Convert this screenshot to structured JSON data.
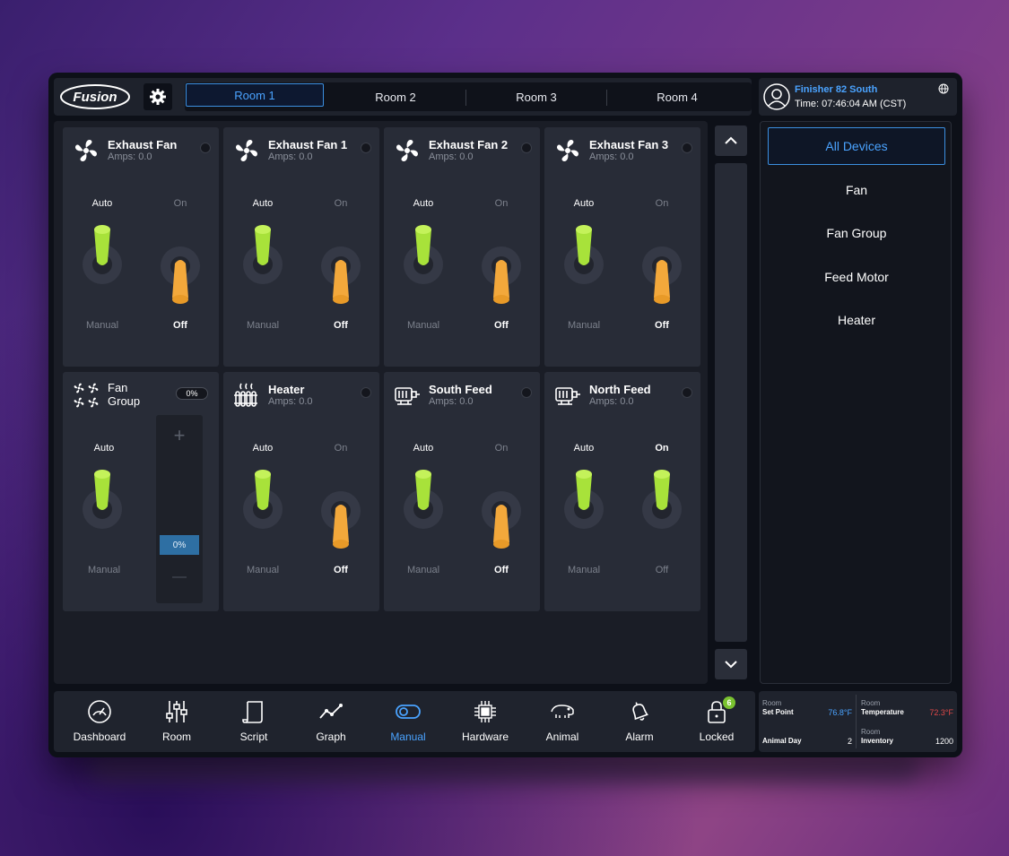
{
  "header": {
    "logo": "Fusion",
    "tabs": [
      {
        "label": "Room 1",
        "active": true
      },
      {
        "label": "Room 2",
        "active": false
      },
      {
        "label": "Room 3",
        "active": false
      },
      {
        "label": "Room 4",
        "active": false
      }
    ],
    "user": {
      "name": "Finisher 82 South",
      "time": "Time: 07:46:04 AM (CST)"
    }
  },
  "cards": [
    {
      "title": "Exhaust Fan",
      "sub": "Amps: 0.0",
      "icon": "fan-icon",
      "left": "Auto",
      "left_bottom": "Manual",
      "right": "On",
      "right_bottom": "Off",
      "left_state": "auto",
      "right_state": "off"
    },
    {
      "title": "Exhaust Fan 1",
      "sub": "Amps: 0.0",
      "icon": "fan-icon",
      "left": "Auto",
      "left_bottom": "Manual",
      "right": "On",
      "right_bottom": "Off",
      "left_state": "auto",
      "right_state": "off"
    },
    {
      "title": "Exhaust Fan 2",
      "sub": "Amps: 0.0",
      "icon": "fan-icon",
      "left": "Auto",
      "left_bottom": "Manual",
      "right": "On",
      "right_bottom": "Off",
      "left_state": "auto",
      "right_state": "off"
    },
    {
      "title": "Exhaust Fan 3",
      "sub": "Amps: 0.0",
      "icon": "fan-icon",
      "left": "Auto",
      "left_bottom": "Manual",
      "right": "On",
      "right_bottom": "Off",
      "left_state": "auto",
      "right_state": "off"
    },
    {
      "title_line1": "Fan",
      "title_line2": "Group",
      "icon": "fan-group-icon",
      "percent": "0%",
      "slider_value": "0%",
      "left": "Auto",
      "left_bottom": "Manual",
      "left_state": "auto",
      "slider_plus": "+",
      "slider_minus": "—"
    },
    {
      "title": "Heater",
      "sub": "Amps: 0.0",
      "icon": "heater-icon",
      "left": "Auto",
      "left_bottom": "Manual",
      "right": "On",
      "right_bottom": "Off",
      "left_state": "auto",
      "right_state": "off"
    },
    {
      "title": "South Feed",
      "sub": "Amps: 0.0",
      "icon": "feed-motor-icon",
      "left": "Auto",
      "left_bottom": "Manual",
      "right": "On",
      "right_bottom": "Off",
      "left_state": "auto",
      "right_state": "off"
    },
    {
      "title": "North Feed",
      "sub": "Amps: 0.0",
      "icon": "feed-motor-icon",
      "left": "Auto",
      "left_bottom": "Manual",
      "right": "On",
      "right_bottom": "Off",
      "left_state": "auto",
      "right_state": "on"
    }
  ],
  "filters": [
    {
      "label": "All Devices",
      "active": true
    },
    {
      "label": "Fan",
      "active": false
    },
    {
      "label": "Fan Group",
      "active": false
    },
    {
      "label": "Feed Motor",
      "active": false
    },
    {
      "label": "Heater",
      "active": false
    }
  ],
  "nav": [
    {
      "label": "Dashboard",
      "icon": "gauge-icon",
      "active": false
    },
    {
      "label": "Room",
      "icon": "sliders-icon",
      "active": false
    },
    {
      "label": "Script",
      "icon": "scroll-icon",
      "active": false
    },
    {
      "label": "Graph",
      "icon": "line-graph-icon",
      "active": false
    },
    {
      "label": "Manual",
      "icon": "toggle-icon",
      "active": true
    },
    {
      "label": "Hardware",
      "icon": "chip-icon",
      "active": false
    },
    {
      "label": "Animal",
      "icon": "pig-icon",
      "active": false
    },
    {
      "label": "Alarm",
      "icon": "bell-icon",
      "active": false
    },
    {
      "label": "Locked",
      "icon": "lock-icon",
      "active": false,
      "badge": "6"
    }
  ],
  "stats": {
    "set_point": {
      "label": "Room",
      "name": "Set Point",
      "value": "76.8°F"
    },
    "temperature": {
      "label": "Room",
      "name": "Temperature",
      "value": "72.3°F"
    },
    "animal_day": {
      "name": "Animal Day",
      "value": "2"
    },
    "inventory": {
      "label": "Room",
      "name": "Inventory",
      "value": "1200"
    }
  },
  "colors": {
    "accent": "#4aa3ff",
    "auto_green": "#a8e23a",
    "off_orange": "#f3a83b",
    "temp_red": "#e04848"
  }
}
